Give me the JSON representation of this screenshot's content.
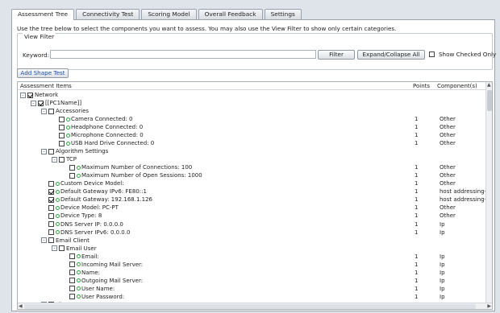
{
  "tabs": [
    {
      "label": "Assessment Tree",
      "active": true
    },
    {
      "label": "Connectivity Test",
      "active": false
    },
    {
      "label": "Scoring Model",
      "active": false
    },
    {
      "label": "Overall Feedback",
      "active": false
    },
    {
      "label": "Settings",
      "active": false
    }
  ],
  "instructions": "Use the tree below to select the components you want to assess. You may also use the View Filter to show only certain categories.",
  "view_filter": {
    "legend": "View Filter",
    "keyword_label": "Keyword:",
    "keyword_value": "",
    "filter_button": "Filter",
    "expand_button": "Expand/Collapse All",
    "show_checked_label": "Show Checked Only",
    "show_checked": false
  },
  "add_shape_button": "Add Shape Test",
  "tree": {
    "headers": {
      "items": "Assessment Items",
      "points": "Points",
      "component": "Component(s)"
    },
    "rows": [
      {
        "label": "Network",
        "checked": true,
        "depth": 0,
        "toggle": "-",
        "leaf": false,
        "points": "",
        "component": ""
      },
      {
        "label": "[[PC1Name]]",
        "checked": true,
        "depth": 1,
        "toggle": "-",
        "leaf": false,
        "points": "",
        "component": ""
      },
      {
        "label": "Accessories",
        "checked": false,
        "depth": 2,
        "toggle": "-",
        "leaf": false,
        "points": "",
        "component": ""
      },
      {
        "label": "Camera Connected: 0",
        "checked": false,
        "depth": 3,
        "toggle": "",
        "leaf": true,
        "points": "1",
        "component": "Other"
      },
      {
        "label": "Headphone Connected: 0",
        "checked": false,
        "depth": 3,
        "toggle": "",
        "leaf": true,
        "points": "1",
        "component": "Other"
      },
      {
        "label": "Microphone Connected: 0",
        "checked": false,
        "depth": 3,
        "toggle": "",
        "leaf": true,
        "points": "1",
        "component": "Other"
      },
      {
        "label": "USB Hard Drive Connected: 0",
        "checked": false,
        "depth": 3,
        "toggle": "",
        "leaf": true,
        "points": "1",
        "component": "Other"
      },
      {
        "label": "Algorithm Settings",
        "checked": false,
        "depth": 2,
        "toggle": "-",
        "leaf": false,
        "points": "",
        "component": ""
      },
      {
        "label": "TCP",
        "checked": false,
        "depth": 3,
        "toggle": "-",
        "leaf": false,
        "points": "",
        "component": ""
      },
      {
        "label": "Maximum Number of Connections: 100",
        "checked": false,
        "depth": 4,
        "toggle": "",
        "leaf": true,
        "points": "1",
        "component": "Other"
      },
      {
        "label": "Maximum Number of Open Sessions: 1000",
        "checked": false,
        "depth": 4,
        "toggle": "",
        "leaf": true,
        "points": "1",
        "component": "Other"
      },
      {
        "label": "Custom Device Model:",
        "checked": false,
        "depth": 2,
        "toggle": "",
        "leaf": true,
        "points": "1",
        "component": "Other"
      },
      {
        "label": "Default Gateway IPv6: FE80::1",
        "checked": true,
        "depth": 2,
        "toggle": "",
        "leaf": true,
        "points": "1",
        "component": "host addressing-p"
      },
      {
        "label": "Default Gateway: 192.168.1.126",
        "checked": true,
        "depth": 2,
        "toggle": "",
        "leaf": true,
        "points": "1",
        "component": "host addressing-p"
      },
      {
        "label": "Device Model: PC-PT",
        "checked": false,
        "depth": 2,
        "toggle": "",
        "leaf": true,
        "points": "1",
        "component": "Other"
      },
      {
        "label": "Device Type: 8",
        "checked": false,
        "depth": 2,
        "toggle": "",
        "leaf": true,
        "points": "1",
        "component": "Other"
      },
      {
        "label": "DNS Server IP: 0.0.0.0",
        "checked": false,
        "depth": 2,
        "toggle": "",
        "leaf": true,
        "points": "1",
        "component": "Ip"
      },
      {
        "label": "DNS Server IPv6: 0.0.0.0",
        "checked": false,
        "depth": 2,
        "toggle": "",
        "leaf": true,
        "points": "1",
        "component": "Ip"
      },
      {
        "label": "Email Client",
        "checked": false,
        "depth": 2,
        "toggle": "-",
        "leaf": false,
        "points": "",
        "component": ""
      },
      {
        "label": "Email User",
        "checked": false,
        "depth": 3,
        "toggle": "-",
        "leaf": false,
        "points": "",
        "component": ""
      },
      {
        "label": "Email:",
        "checked": false,
        "depth": 4,
        "toggle": "",
        "leaf": true,
        "points": "1",
        "component": "Ip"
      },
      {
        "label": "Incoming Mail Server:",
        "checked": false,
        "depth": 4,
        "toggle": "",
        "leaf": true,
        "points": "1",
        "component": "Ip"
      },
      {
        "label": "Name:",
        "checked": false,
        "depth": 4,
        "toggle": "",
        "leaf": true,
        "points": "1",
        "component": "Ip"
      },
      {
        "label": "Outgoing Mail Server:",
        "checked": false,
        "depth": 4,
        "toggle": "",
        "leaf": true,
        "points": "1",
        "component": "Ip"
      },
      {
        "label": "User Name:",
        "checked": false,
        "depth": 4,
        "toggle": "",
        "leaf": true,
        "points": "1",
        "component": "Ip"
      },
      {
        "label": "User Password:",
        "checked": false,
        "depth": 4,
        "toggle": "",
        "leaf": true,
        "points": "1",
        "component": "Ip"
      },
      {
        "label": "Files",
        "checked": false,
        "depth": 2,
        "toggle": "-",
        "leaf": false,
        "points": "",
        "component": ""
      }
    ]
  },
  "colors": {
    "leaf_dot": "#2ea53a",
    "link_text": "#1f4fa3"
  }
}
